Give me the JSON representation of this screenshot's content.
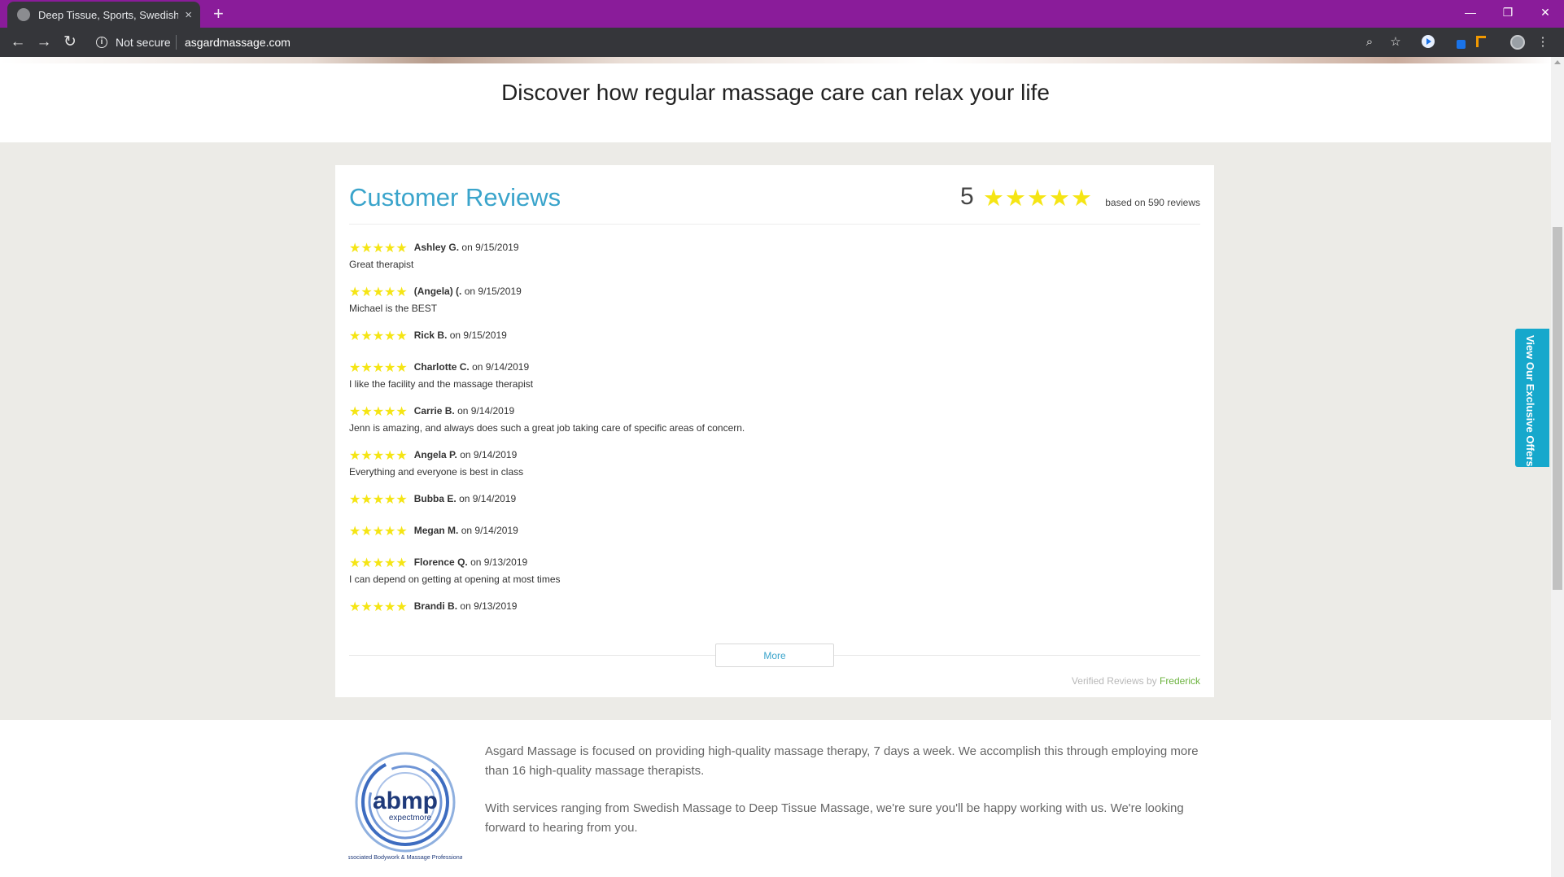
{
  "browser": {
    "tab_title": "Deep Tissue, Sports, Swedish Massage",
    "tab_close": "×",
    "new_tab": "+",
    "security_label": "Not secure",
    "url": "asgardmassage.com",
    "win_minimize": "—",
    "win_restore": "❐",
    "win_close": "✕",
    "back": "←",
    "forward": "→",
    "reload": "↻",
    "zoom_icon": "⌕",
    "star_icon": "☆",
    "menu_icon": "⋮",
    "info_icon": "i"
  },
  "page": {
    "tagline": "Discover how regular massage care can relax your life"
  },
  "reviews": {
    "title": "Customer Reviews",
    "overall_score": "5",
    "overall_rating": 5,
    "count_text": "based on 590 reviews",
    "star_color": "#f5e514",
    "items": [
      {
        "name": "Ashley G.",
        "date": "on 9/15/2019",
        "text": "Great therapist",
        "rating": 5
      },
      {
        "name": "(Angela) (.",
        "date": "on 9/15/2019",
        "text": "Michael is the BEST",
        "rating": 5
      },
      {
        "name": "Rick B.",
        "date": "on 9/15/2019",
        "text": "",
        "rating": 5
      },
      {
        "name": "Charlotte C.",
        "date": "on 9/14/2019",
        "text": "I like the facility and the massage therapist",
        "rating": 5
      },
      {
        "name": "Carrie B.",
        "date": "on 9/14/2019",
        "text": "Jenn is amazing, and always does such a great job taking care of specific areas of concern.",
        "rating": 5
      },
      {
        "name": "Angela P.",
        "date": "on 9/14/2019",
        "text": "Everything and everyone is best in class",
        "rating": 5
      },
      {
        "name": "Bubba E.",
        "date": "on 9/14/2019",
        "text": "",
        "rating": 5
      },
      {
        "name": "Megan M.",
        "date": "on 9/14/2019",
        "text": "",
        "rating": 5
      },
      {
        "name": "Florence Q.",
        "date": "on 9/13/2019",
        "text": "I can depend on getting at opening at most times",
        "rating": 5
      },
      {
        "name": "Brandi B.",
        "date": "on 9/13/2019",
        "text": "",
        "rating": 5
      }
    ],
    "more_label": "More",
    "verified_prefix": "Verified Reviews by",
    "verified_brand": "Frederick"
  },
  "about": {
    "logo_text": "abmp",
    "logo_tagline": "expectmore",
    "logo_caption": "Associated Bodywork & Massage Professionals",
    "paragraph1": "Asgard Massage is focused on providing high-quality massage therapy, 7 days a week. We accomplish this through employing more than 16 high-quality massage therapists.",
    "paragraph2": "With services ranging from Swedish Massage to Deep Tissue Massage, we're sure you'll be happy working with us. We're looking forward to hearing from you."
  },
  "offers_tab": {
    "label": "View Our Exclusive Offers",
    "color": "#16a8cc"
  }
}
